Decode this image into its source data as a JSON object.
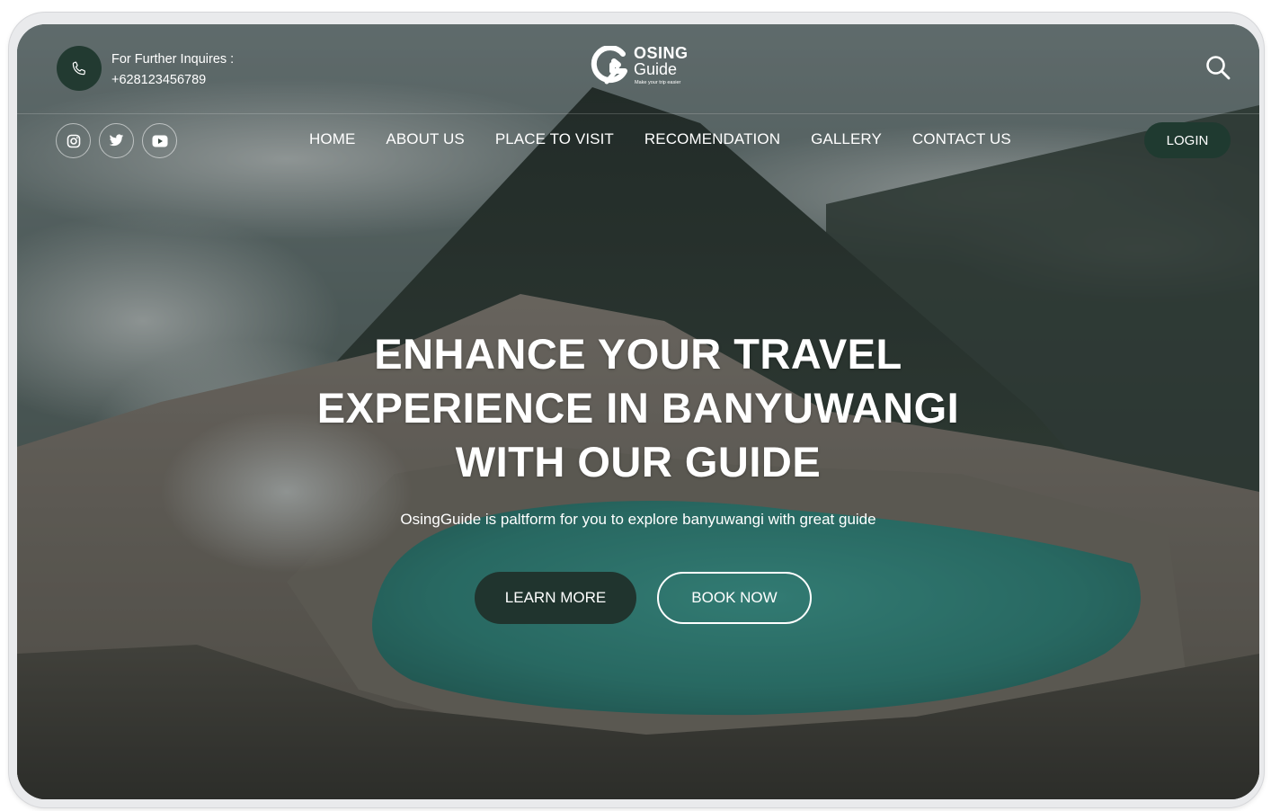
{
  "header": {
    "inquiry_label": "For Further Inquires :",
    "phone_number": "+628123456789",
    "phone_icon": "phone-icon",
    "search_icon": "search-icon"
  },
  "logo": {
    "title": "OSING",
    "subtitle": "Guide",
    "tagline": "Make your trip easier"
  },
  "social": [
    {
      "name": "instagram",
      "icon": "instagram-icon"
    },
    {
      "name": "twitter",
      "icon": "twitter-icon"
    },
    {
      "name": "youtube",
      "icon": "youtube-icon"
    }
  ],
  "nav": {
    "items": [
      {
        "label": "HOME"
      },
      {
        "label": "ABOUT US"
      },
      {
        "label": "PLACE TO VISIT"
      },
      {
        "label": "RECOMENDATION"
      },
      {
        "label": "GALLERY"
      },
      {
        "label": "CONTACT US"
      }
    ],
    "login_label": "LOGIN"
  },
  "hero": {
    "title_lines": [
      "ENHANCE YOUR TRAVEL",
      "EXPERIENCE IN BANYUWANGI",
      "WITH OUR GUIDE"
    ],
    "subtitle": "OsingGuide is paltform for you to explore banyuwangi with great guide",
    "learn_more_label": "LEARN MORE",
    "book_now_label": "BOOK NOW"
  },
  "colors": {
    "brand_dark_green": "#1f3a30",
    "text_white": "#ffffff",
    "crater_lake": "#3aa398"
  }
}
